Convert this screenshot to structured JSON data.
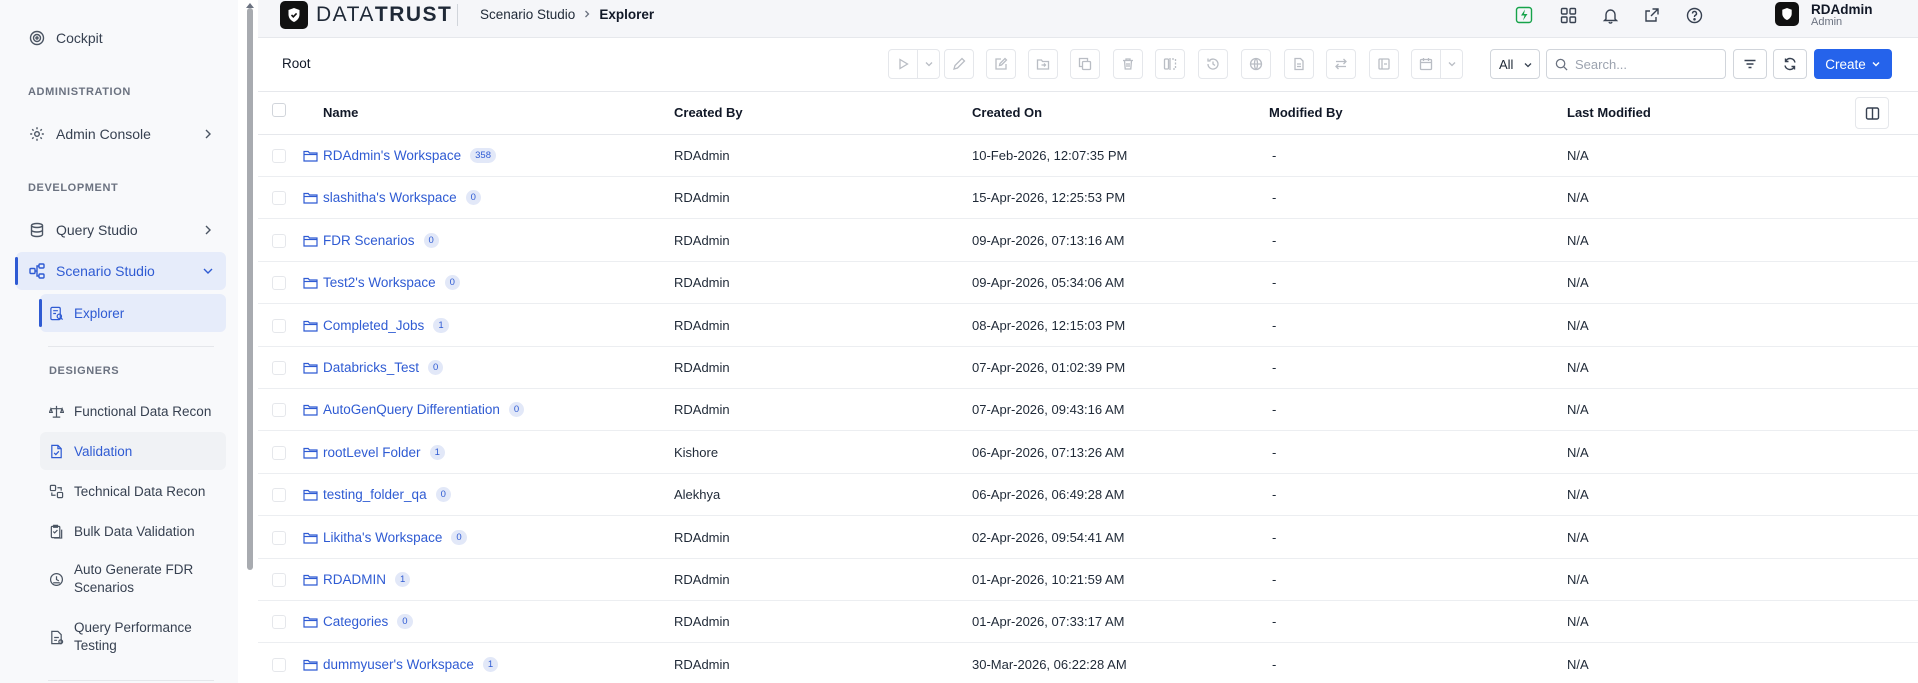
{
  "sidebar": {
    "cockpit": "Cockpit",
    "section_administration": "ADMINISTRATION",
    "admin_console": "Admin Console",
    "section_development": "DEVELOPMENT",
    "query_studio": "Query Studio",
    "scenario_studio": "Scenario Studio",
    "explorer": "Explorer",
    "section_designers": "DESIGNERS",
    "designers": [
      "Functional Data Recon",
      "Validation",
      "Technical Data Recon",
      "Bulk Data Validation",
      "Auto Generate FDR Scenarios",
      "Query Performance Testing"
    ]
  },
  "header": {
    "logo_text_1": "DATA",
    "logo_text_2": "TRUST",
    "breadcrumb_parent": "Scenario Studio",
    "breadcrumb_current": "Explorer",
    "user_name": "RDAdmin",
    "user_role": "Admin",
    "icons": [
      "activity-icon",
      "apps-grid-icon",
      "bell-icon",
      "external-link-icon",
      "help-icon"
    ]
  },
  "toolbar": {
    "root_label": "Root",
    "filter_select": "All",
    "search_placeholder": "Search...",
    "create_label": "Create"
  },
  "table": {
    "columns": [
      "Name",
      "Created By",
      "Created On",
      "Modified By",
      "Last Modified"
    ],
    "rows": [
      {
        "name": "RDAdmin's Workspace",
        "count": "358",
        "created_by": "RDAdmin",
        "created_on": "10-Feb-2026, 12:07:35 PM",
        "modified_by": "-",
        "last_modified": "N/A"
      },
      {
        "name": "slashitha's Workspace",
        "count": "0",
        "created_by": "RDAdmin",
        "created_on": "15-Apr-2026, 12:25:53 PM",
        "modified_by": "-",
        "last_modified": "N/A"
      },
      {
        "name": "FDR Scenarios",
        "count": "0",
        "created_by": "RDAdmin",
        "created_on": "09-Apr-2026, 07:13:16 AM",
        "modified_by": "-",
        "last_modified": "N/A"
      },
      {
        "name": "Test2's Workspace",
        "count": "0",
        "created_by": "RDAdmin",
        "created_on": "09-Apr-2026, 05:34:06 AM",
        "modified_by": "-",
        "last_modified": "N/A"
      },
      {
        "name": "Completed_Jobs",
        "count": "1",
        "created_by": "RDAdmin",
        "created_on": "08-Apr-2026, 12:15:03 PM",
        "modified_by": "-",
        "last_modified": "N/A"
      },
      {
        "name": "Databricks_Test",
        "count": "0",
        "created_by": "RDAdmin",
        "created_on": "07-Apr-2026, 01:02:39 PM",
        "modified_by": "-",
        "last_modified": "N/A"
      },
      {
        "name": "AutoGenQuery Differentiation",
        "count": "0",
        "created_by": "RDAdmin",
        "created_on": "07-Apr-2026, 09:43:16 AM",
        "modified_by": "-",
        "last_modified": "N/A"
      },
      {
        "name": "rootLevel Folder",
        "count": "1",
        "created_by": "Kishore",
        "created_on": "06-Apr-2026, 07:13:26 AM",
        "modified_by": "-",
        "last_modified": "N/A"
      },
      {
        "name": "testing_folder_qa",
        "count": "0",
        "created_by": "Alekhya",
        "created_on": "06-Apr-2026, 06:49:28 AM",
        "modified_by": "-",
        "last_modified": "N/A"
      },
      {
        "name": "Likitha's Workspace",
        "count": "0",
        "created_by": "RDAdmin",
        "created_on": "02-Apr-2026, 09:54:41 AM",
        "modified_by": "-",
        "last_modified": "N/A"
      },
      {
        "name": "RDADMIN",
        "count": "1",
        "created_by": "RDAdmin",
        "created_on": "01-Apr-2026, 10:21:59 AM",
        "modified_by": "-",
        "last_modified": "N/A"
      },
      {
        "name": "Categories",
        "count": "0",
        "created_by": "RDAdmin",
        "created_on": "01-Apr-2026, 07:33:17 AM",
        "modified_by": "-",
        "last_modified": "N/A"
      },
      {
        "name": "dummyuser's Workspace",
        "count": "1",
        "created_by": "RDAdmin",
        "created_on": "30-Mar-2026, 06:22:28 AM",
        "modified_by": "-",
        "last_modified": "N/A"
      }
    ]
  },
  "colors": {
    "accent": "#2f5bd3",
    "primary_button": "#2563eb",
    "active_bg": "#e6ecfa",
    "activity_icon": "#16a34a"
  }
}
